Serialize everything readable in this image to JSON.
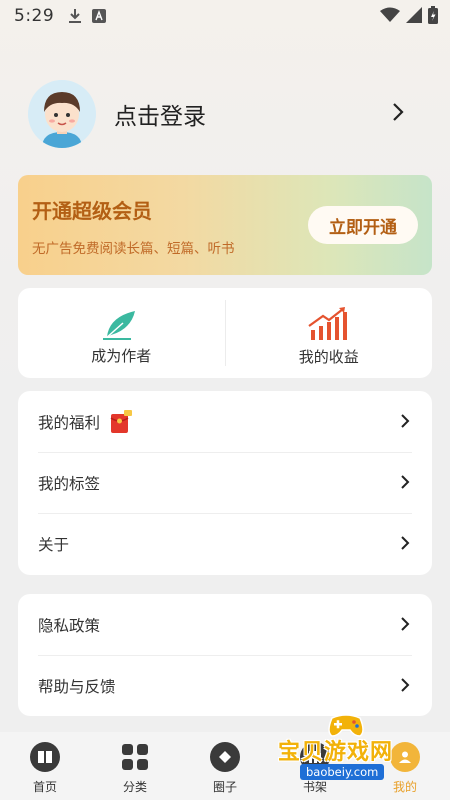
{
  "status_bar": {
    "time": "5:29"
  },
  "profile": {
    "login_text": "点击登录"
  },
  "vip": {
    "title": "开通超级会员",
    "description": "无广告免费阅读长篇、短篇、听书",
    "button_label": "立即开通"
  },
  "quick_actions": [
    {
      "label": "成为作者",
      "icon": "feather-pen-icon"
    },
    {
      "label": "我的收益",
      "icon": "earnings-chart-icon"
    }
  ],
  "menu_group_1": [
    {
      "label": "我的福利"
    },
    {
      "label": "我的标签"
    },
    {
      "label": "关于"
    }
  ],
  "menu_group_2": [
    {
      "label": "隐私政策"
    },
    {
      "label": "帮助与反馈"
    }
  ],
  "tabbar": {
    "items": [
      {
        "label": "首页",
        "icon": "book-icon"
      },
      {
        "label": "分类",
        "icon": "grid-icon"
      },
      {
        "label": "圈子",
        "icon": "circle-icon"
      },
      {
        "label": "书架",
        "icon": "shelf-icon"
      },
      {
        "label": "我的",
        "icon": "user-icon"
      }
    ],
    "active_index": 4
  },
  "watermark": {
    "title": "宝贝游戏网",
    "url": "baobeiy.com"
  },
  "colors": {
    "vip_text": "#b35f14",
    "accent_green": "#3bb9a0",
    "accent_red": "#e5532f",
    "tab_active": "#e8a02a"
  }
}
